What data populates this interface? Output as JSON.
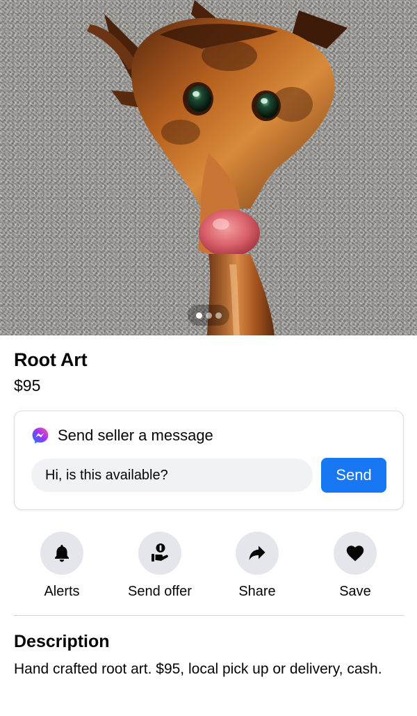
{
  "listing": {
    "title": "Root Art",
    "price": "$95",
    "photo_count": 3,
    "active_photo": 1
  },
  "message_card": {
    "title": "Send seller a message",
    "input_value": "Hi, is this available?",
    "send_label": "Send",
    "icon": "messenger-icon"
  },
  "actions": [
    {
      "label": "Alerts",
      "icon": "bell-icon"
    },
    {
      "label": "Send offer",
      "icon": "offer-hand-icon"
    },
    {
      "label": "Share",
      "icon": "share-arrow-icon"
    },
    {
      "label": "Save",
      "icon": "heart-icon"
    }
  ],
  "description": {
    "title": "Description",
    "text": "Hand crafted root art.  $95, local pick up or delivery, cash."
  },
  "colors": {
    "accent": "#1877f2",
    "button_bg": "#e4e6eb",
    "input_bg": "#f0f2f5",
    "text": "#050505"
  }
}
